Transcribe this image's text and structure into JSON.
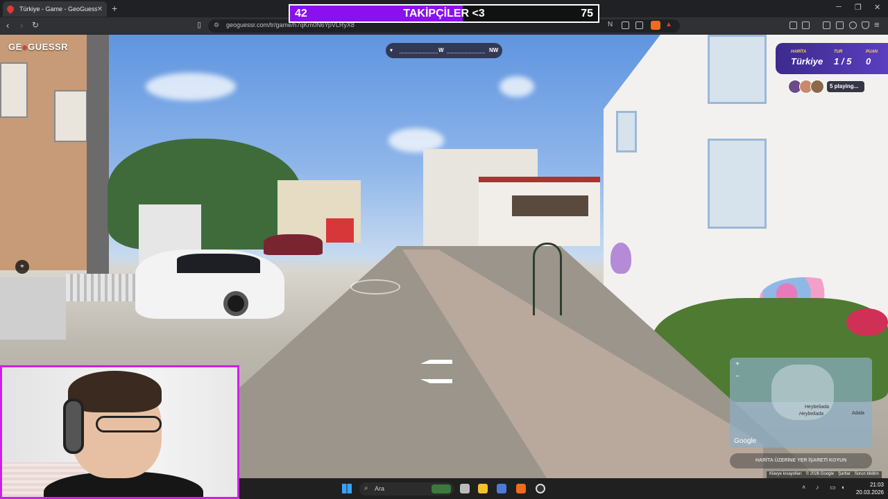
{
  "browser": {
    "tab_title": "Türkiye - Game - GeoGuessr",
    "url": "geoguessr.com/tr/game/h7qKm0N6YpVLRyX8"
  },
  "stream_overlay": {
    "left_count": "42",
    "label": "TAKİPÇİLER <3",
    "right_count": "75",
    "fill_fraction": 0.56,
    "fill_color": "#8a10f0"
  },
  "game": {
    "logo_prefix": "GE",
    "logo_suffix": "GUESSR",
    "compass": [
      "W",
      "NW"
    ],
    "map_label": "HARİTA",
    "map_value": "Türkiye",
    "round_label": "TUR",
    "round_value": "1 / 5",
    "score_label": "PUAN",
    "score_value": "0",
    "playing_text": "5 playing...",
    "minimap_labels": [
      "Heybeliada",
      "Heybeliada",
      "Adala",
      "Google"
    ],
    "guess_button": "HARİTA ÜZERİNE YER İŞARETİ KOYUN"
  },
  "footer_links": [
    "Klavye kısayolları",
    "© 2026 Google",
    "Şartlar",
    "Sorun bildirin"
  ],
  "taskbar": {
    "search_placeholder": "Ara",
    "time": "21:03",
    "date": "20.03.2026"
  },
  "icons": [
    "browser-back-icon",
    "browser-forward-icon",
    "reload-icon",
    "bookmark-icon",
    "search-icon",
    "windows-start-icon"
  ]
}
